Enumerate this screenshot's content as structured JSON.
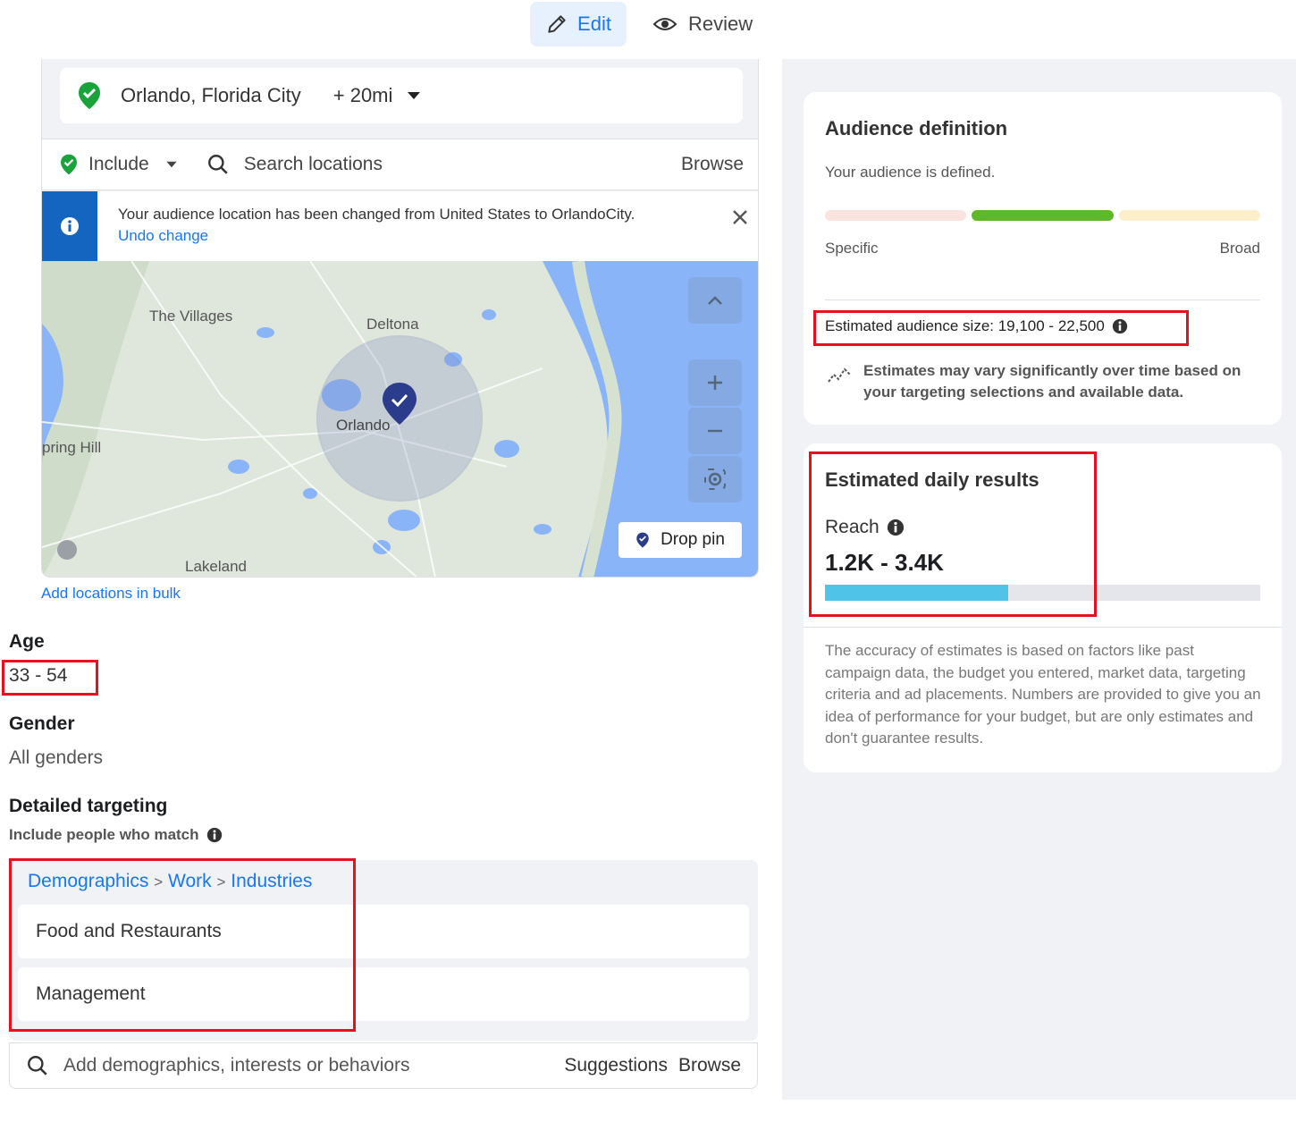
{
  "tabs": {
    "edit": "Edit",
    "review": "Review"
  },
  "location": {
    "city": "Orlando, Florida City",
    "radius": "+ 20mi",
    "include_label": "Include",
    "search_placeholder": "Search locations",
    "browse_label": "Browse",
    "notice_text": "Your audience location has been changed from United States to OrlandoCity.",
    "undo_label": "Undo change",
    "map_labels": {
      "villages": "The Villages",
      "deltona": "Deltona",
      "orlando": "Orlando",
      "spring_hill": "pring Hill",
      "lakeland": "Lakeland"
    },
    "drop_pin_label": "Drop pin",
    "add_bulk_label": "Add locations in bulk"
  },
  "age": {
    "label": "Age",
    "value": "33 - 54"
  },
  "gender": {
    "label": "Gender",
    "value": "All genders"
  },
  "detailed_targeting": {
    "title": "Detailed targeting",
    "subtitle": "Include people who match",
    "breadcrumb": [
      "Demographics",
      "Work",
      "Industries"
    ],
    "breadcrumb_sep": ">",
    "items": [
      "Food and Restaurants",
      "Management"
    ],
    "search_placeholder": "Add demographics, interests or behaviors",
    "suggestions_label": "Suggestions",
    "browse_label": "Browse"
  },
  "audience_definition": {
    "title": "Audience definition",
    "status": "Your audience is defined.",
    "specific_label": "Specific",
    "broad_label": "Broad",
    "estimated_size": "Estimated audience size: 19,100 - 22,500",
    "vary_note": "Estimates may vary significantly over time based on your targeting selections and available data.",
    "colors": {
      "low": "#fbe3e0",
      "mid": "#5eb82b",
      "high": "#fcefc9"
    }
  },
  "daily_results": {
    "title": "Estimated daily results",
    "reach_label": "Reach",
    "reach_value": "1.2K - 3.4K",
    "reach_fill_fraction": 0.42,
    "bar_color": "#4fc3e8",
    "accuracy_note": "The accuracy of estimates is based on factors like past campaign data, the budget you entered, market data, targeting criteria and ad placements. Numbers are provided to give you an idea of performance for your budget, but are only estimates and don't guarantee results."
  },
  "colors": {
    "accent": "#1877f2",
    "highlight": "#e8101e",
    "notice": "#1465c0"
  }
}
